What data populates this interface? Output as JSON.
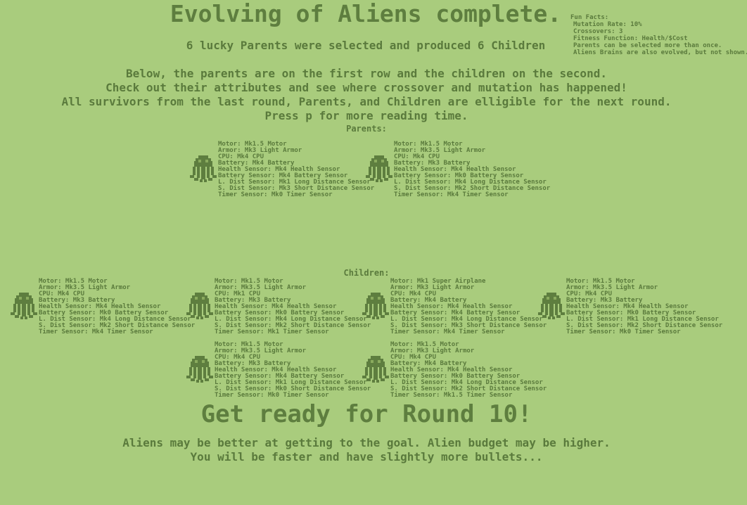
{
  "title": "Evolving of Aliens complete.",
  "subtitle": "6 lucky Parents were selected and produced 6 Children",
  "fun_facts": {
    "title": "Fun Facts:",
    "lines": [
      "Mutation Rate: 10%",
      "Crossovers: 3",
      "Fitness Function: Health/$Cost",
      "Parents can be selected more than once.",
      "Aliens Brains are also evolved, but not shown."
    ]
  },
  "intro": [
    "Below, the parents are on the first row and the children on the second.",
    "Check out their attributes and see where crossover and mutation has happened!",
    "All survivors from the last round, Parents, and Children are elligible for the next round.",
    "Press p for more reading time."
  ],
  "parents_label": "Parents:",
  "children_label": "Children:",
  "parents": [
    [
      "Motor: Mk1.5 Motor",
      "Armor: Mk3 Light Armor",
      "CPU: Mk4 CPU",
      "Battery: Mk4 Battery",
      "Health Sensor: Mk4 Health Sensor",
      "Battery Sensor: Mk4 Battery Sensor",
      "L. Dist Sensor: Mk1 Long Distance Sensor",
      "S. Dist Sensor: Mk3 Short Distance Sensor",
      "Timer Sensor: Mk0 Timer Sensor"
    ],
    [
      "Motor: Mk1.5 Motor",
      "Armor: Mk3.5 Light Armor",
      "CPU: Mk4 CPU",
      "Battery: Mk3 Battery",
      "Health Sensor: Mk4 Health Sensor",
      "Battery Sensor: Mk0 Battery Sensor",
      "L. Dist Sensor: Mk4 Long Distance Sensor",
      "S. Dist Sensor: Mk2 Short Distance Sensor",
      "Timer Sensor: Mk4 Timer Sensor"
    ]
  ],
  "children": [
    [
      "Motor: Mk1.5 Motor",
      "Armor: Mk3.5 Light Armor",
      "CPU: Mk4 CPU",
      "Battery: Mk3 Battery",
      "Health Sensor: Mk4 Health Sensor",
      "Battery Sensor: Mk0 Battery Sensor",
      "L. Dist Sensor: Mk4 Long Distance Sensor",
      "S. Dist Sensor: Mk2 Short Distance Sensor",
      "Timer Sensor: Mk4 Timer Sensor"
    ],
    [
      "Motor: Mk1.5 Motor",
      "Armor: Mk3.5 Light Armor",
      "CPU: Mk1 CPU",
      "Battery: Mk3 Battery",
      "Health Sensor: Mk4 Health Sensor",
      "Battery Sensor: Mk0 Battery Sensor",
      "L. Dist Sensor: Mk4 Long Distance Sensor",
      "S. Dist Sensor: Mk2 Short Distance Sensor",
      "Timer Sensor: Mk1 Timer Sensor"
    ],
    [
      "Motor: Mk1 Super Airplane",
      "Armor: Mk3 Light Armor",
      "CPU: Mk4 CPU",
      "Battery: Mk4 Battery",
      "Health Sensor: Mk4 Health Sensor",
      "Battery Sensor: Mk4 Battery Sensor",
      "L. Dist Sensor: Mk4 Long Distance Sensor",
      "S. Dist Sensor: Mk3 Short Distance Sensor",
      "Timer Sensor: Mk4 Timer Sensor"
    ],
    [
      "Motor: Mk1.5 Motor",
      "Armor: Mk3.5 Light Armor",
      "CPU: Mk4 CPU",
      "Battery: Mk3 Battery",
      "Health Sensor: Mk4 Health Sensor",
      "Battery Sensor: Mk0 Battery Sensor",
      "L. Dist Sensor: Mk1 Long Distance Sensor",
      "S. Dist Sensor: Mk2 Short Distance Sensor",
      "Timer Sensor: Mk0 Timer Sensor"
    ],
    [
      "Motor: Mk1.5 Motor",
      "Armor: Mk3.5 Light Armor",
      "CPU: Mk4 CPU",
      "Battery: Mk3 Battery",
      "Health Sensor: Mk4 Health Sensor",
      "Battery Sensor: Mk4 Battery Sensor",
      "L. Dist Sensor: Mk1 Long Distance Sensor",
      "S. Dist Sensor: Mk0 Short Distance Sensor",
      "Timer Sensor: Mk0 Timer Sensor"
    ],
    [
      "Motor: Mk1.5 Motor",
      "Armor: Mk3 Light Armor",
      "CPU: Mk4 CPU",
      "Battery: Mk4 Battery",
      "Health Sensor: Mk4 Health Sensor",
      "Battery Sensor: Mk0 Battery Sensor",
      "L. Dist Sensor: Mk4 Long Distance Sensor",
      "S. Dist Sensor: Mk2 Short Distance Sensor",
      "Timer Sensor: Mk1.5 Timer Sensor"
    ]
  ],
  "round_text": "Get ready for Round 10!",
  "footer": [
    "Aliens may be better at getting to the goal. Alien budget may be higher.",
    "You will be faster and have slightly more bullets..."
  ],
  "colors": {
    "background": "#a9cc7d",
    "text": "#5a7a3c",
    "alien": "#5e7e3f"
  }
}
